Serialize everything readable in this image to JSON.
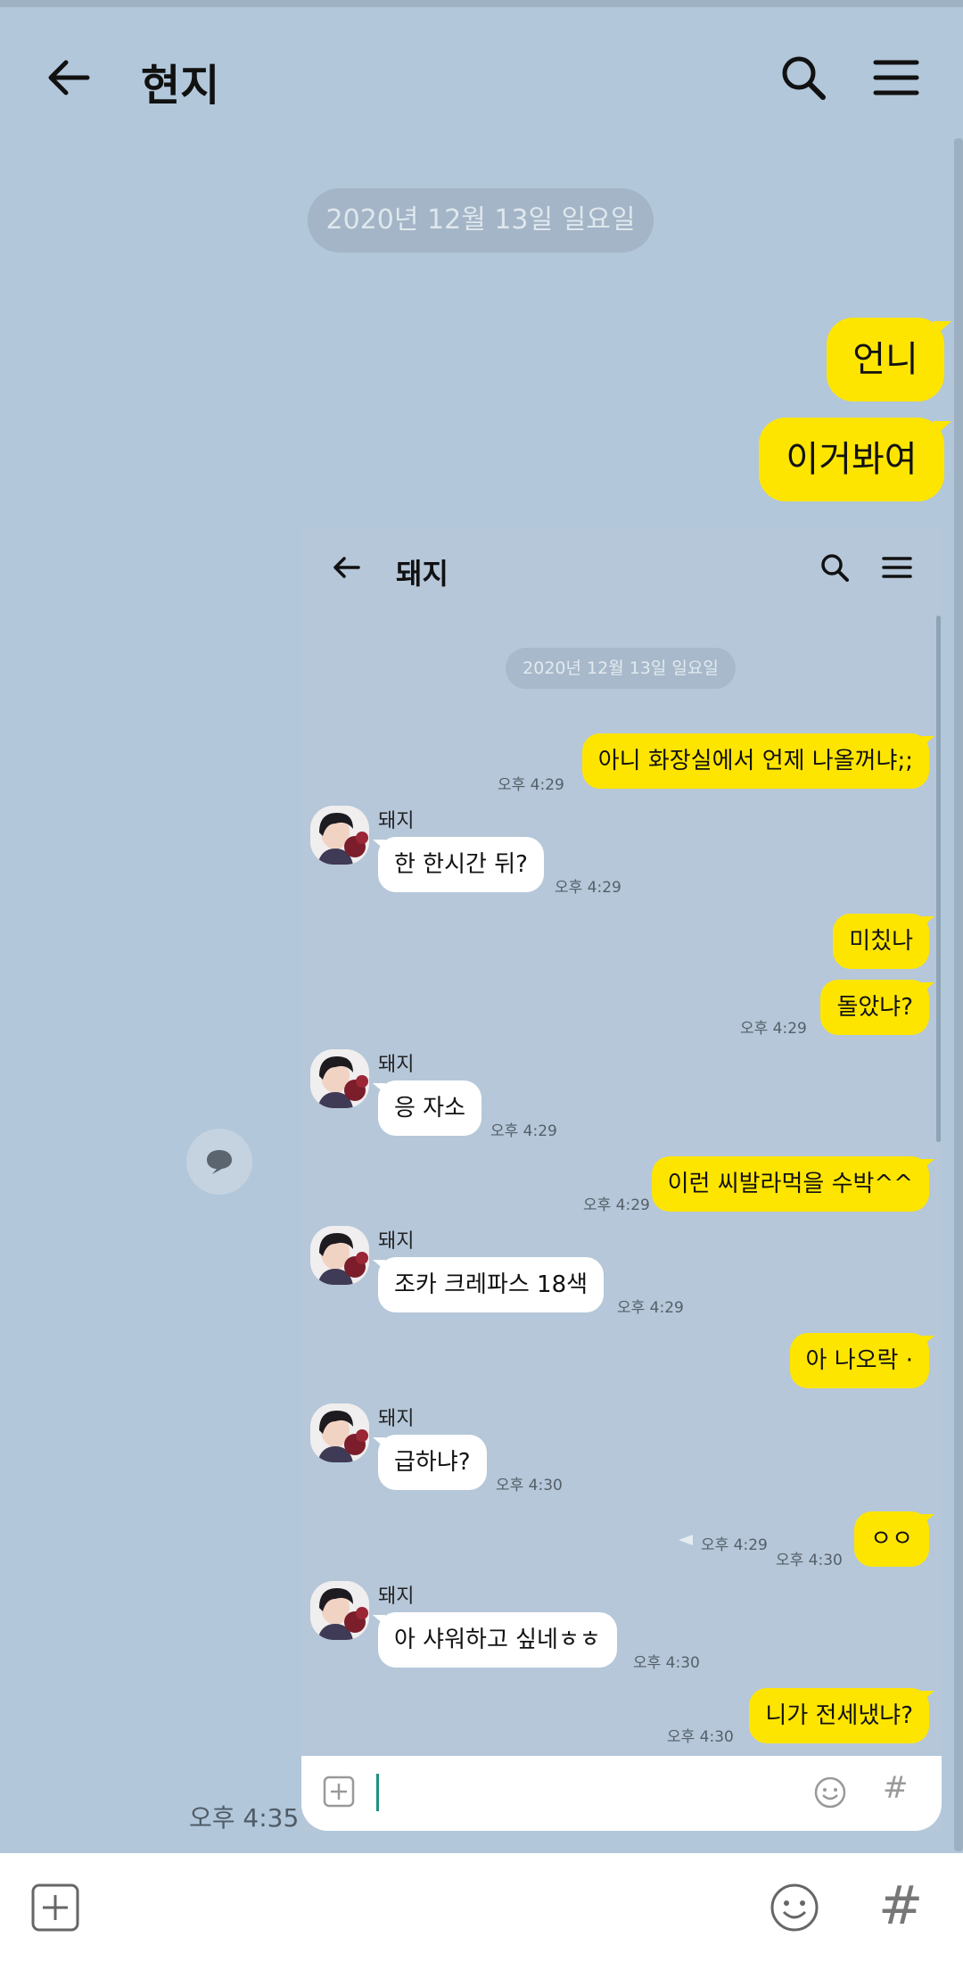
{
  "header": {
    "title": "현지"
  },
  "date_pill": "2020년 12월 13일 일요일",
  "messages_out": [
    "언니",
    "이거봐여"
  ],
  "message_time": "오후 4:35",
  "shot": {
    "title": "돼지",
    "date_pill": "2020년 12월 13일 일요일",
    "sender_name": "돼지",
    "messages": [
      {
        "side": "out",
        "text": "아니 화장실에서 언제 나올꺼냐;;",
        "time": "오후 4:29"
      },
      {
        "side": "in",
        "text": "한 한시간 뒤?",
        "time": "오후 4:29"
      },
      {
        "side": "out",
        "text": "미칬나",
        "time": ""
      },
      {
        "side": "out",
        "text": "돌았냐?",
        "time": "오후 4:29"
      },
      {
        "side": "in",
        "text": "응 자소",
        "time": "오후 4:29"
      },
      {
        "side": "out",
        "text": "이런 씨발라먹을 수박^^",
        "time": "오후 4:29"
      },
      {
        "side": "in",
        "text": "조카 크레파스 18색",
        "time": "오후 4:29"
      },
      {
        "side": "out",
        "text": "아 나오락 ·",
        "time": "오후 4:29"
      },
      {
        "side": "in",
        "text": "급하냐?",
        "time": "오후 4:30"
      },
      {
        "side": "out",
        "text": "ㅇㅇ",
        "time": "오후 4:30"
      },
      {
        "side": "in",
        "text": "아 샤워하고 싶네ㅎㅎ",
        "time": "오후 4:30"
      },
      {
        "side": "out",
        "text": "니가 전세냈냐?",
        "time": "오후 4:30"
      }
    ]
  },
  "input": {
    "hash_label": "#"
  },
  "colors": {
    "background": "#b2c7da",
    "outgoing_bubble": "#fee500",
    "incoming_bubble": "#ffffff"
  },
  "icons": [
    "back-arrow-icon",
    "search-icon",
    "menu-icon",
    "plus-icon",
    "emoji-icon",
    "share-icon"
  ]
}
